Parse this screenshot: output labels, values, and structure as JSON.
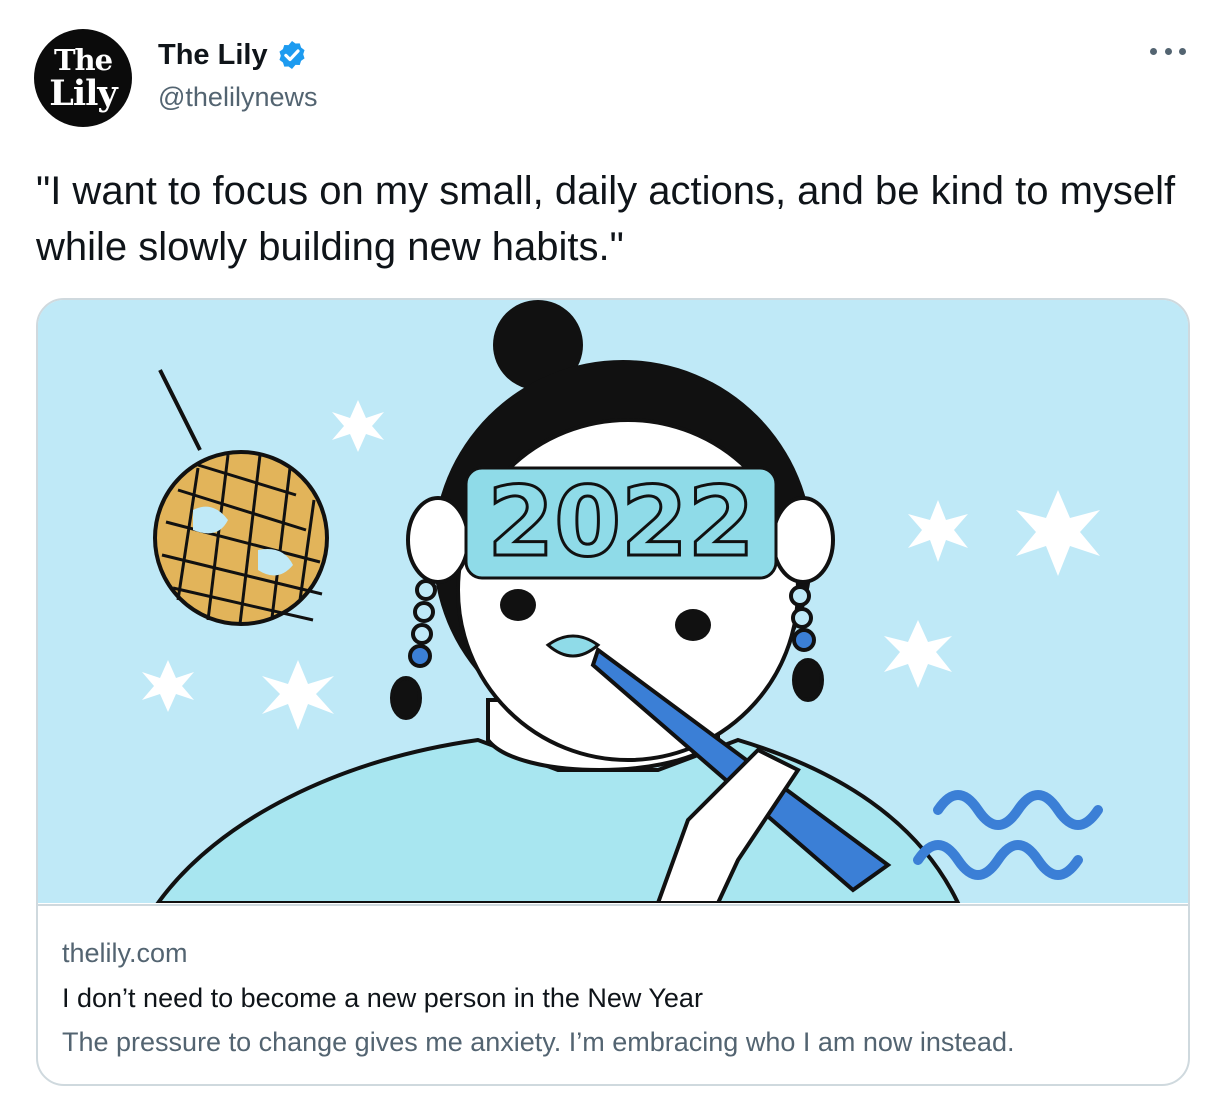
{
  "author": {
    "display_name": "The Lily",
    "handle": "@thelilynews",
    "avatar_text_top": "The",
    "avatar_text_bottom": "Lily",
    "verified_color": "#1d9bf0"
  },
  "tweet": {
    "text": "\"I want to focus on my small, daily actions, and be kind to myself while slowly building new habits.\""
  },
  "card": {
    "domain": "thelily.com",
    "title": "I don’t need to become a new person in the New Year",
    "description": "The pressure to change gives me anxiety. I’m embracing who I am now instead.",
    "image_text": "2022",
    "image_background": "#bfe9f7"
  },
  "colors": {
    "text_primary": "#0f1419",
    "text_secondary": "#536471",
    "border": "#cfd9de"
  }
}
